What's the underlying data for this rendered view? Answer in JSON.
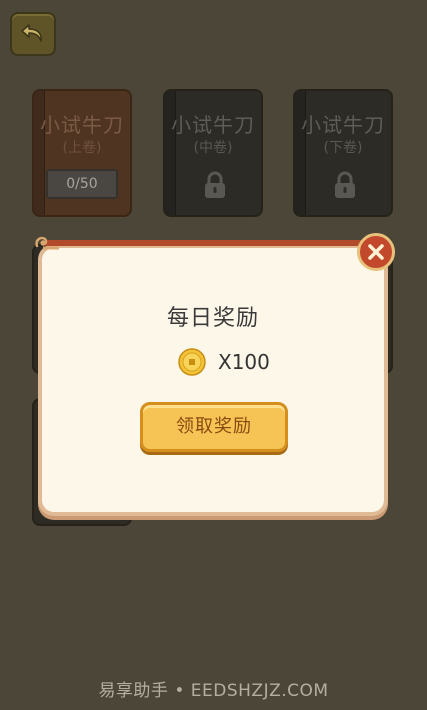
{
  "books": [
    {
      "title": "小试牛刀",
      "sub": "(上卷)",
      "progress": "0/50",
      "locked": false
    },
    {
      "title": "小试牛刀",
      "sub": "(中卷)",
      "locked": true
    },
    {
      "title": "小试牛刀",
      "sub": "(下卷)",
      "locked": true
    }
  ],
  "dialog": {
    "title": "每日奖励",
    "reward": "X100",
    "claim_label": "领取奖励"
  },
  "watermark": "易享助手 • EEDSHZJZ.COM",
  "colors": {
    "background": "#4b4637",
    "dialog_bg": "#fdf7ea",
    "button": "#f6c454",
    "close": "#c2492c"
  }
}
